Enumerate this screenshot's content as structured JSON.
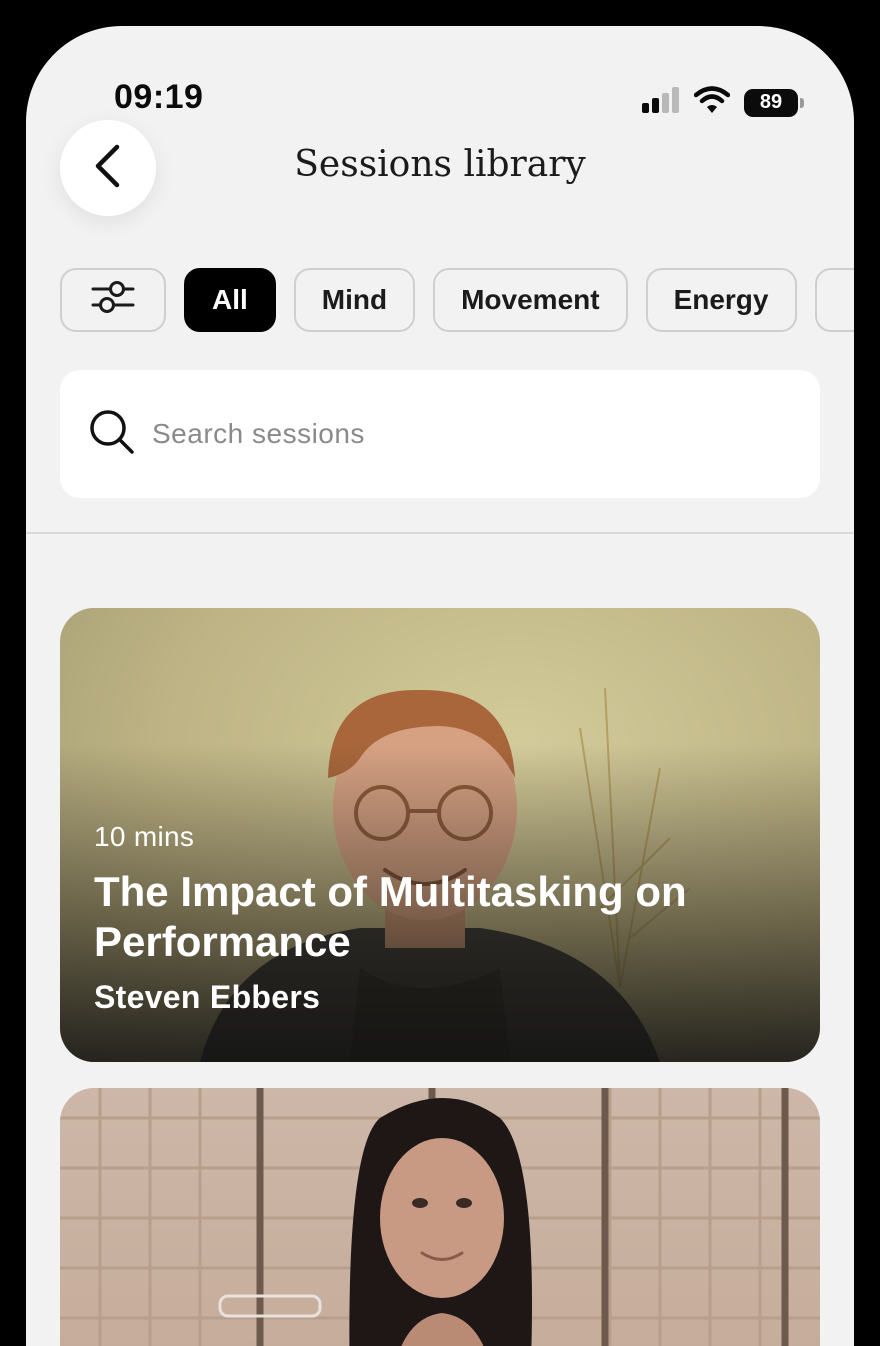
{
  "status_bar": {
    "time": "09:19",
    "battery": "89",
    "icons": [
      "signal-icon",
      "wifi-icon",
      "battery-icon"
    ]
  },
  "header": {
    "title": "Sessions library",
    "back_icon": "chevron-left-icon"
  },
  "filters": {
    "icon": "sliders-icon",
    "chips": [
      "All",
      "Mind",
      "Movement",
      "Energy"
    ],
    "active": "All"
  },
  "search": {
    "placeholder": "Search sessions",
    "value": "",
    "icon": "search-icon"
  },
  "sessions": [
    {
      "duration": "10 mins",
      "title": "The Impact of Multitasking on Performance",
      "author": "Steven Ebbers"
    }
  ],
  "colors": {
    "active_chip": "#000000",
    "background": "#f1f2f1",
    "card_text": "#ffffff"
  }
}
